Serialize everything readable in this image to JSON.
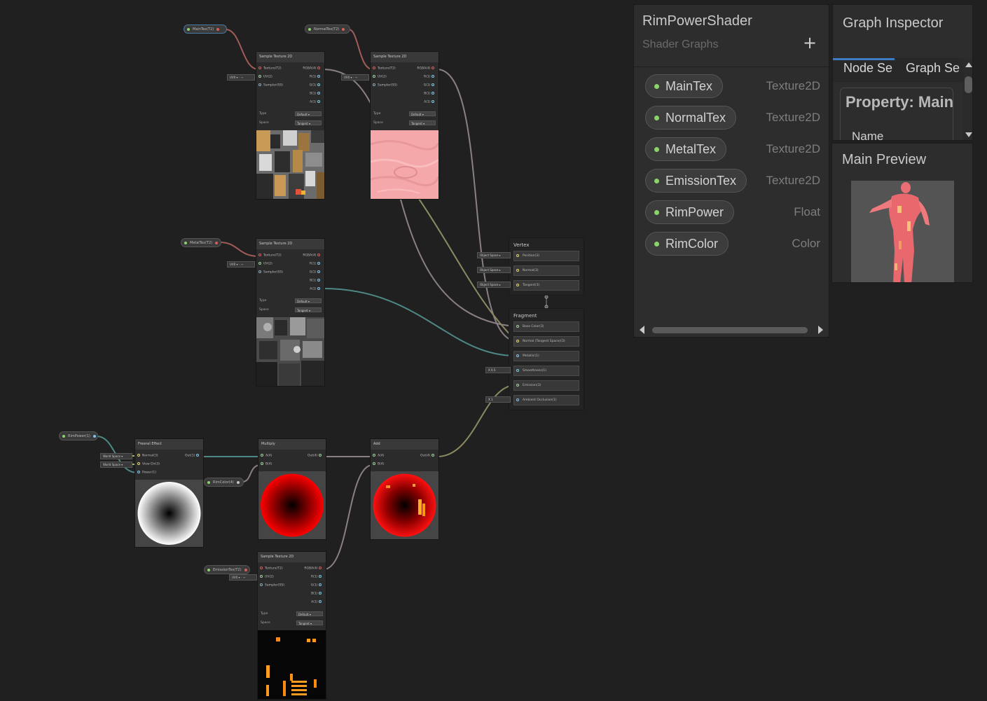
{
  "blackboard": {
    "title": "RimPowerShader",
    "subtitle": "Shader Graphs",
    "add_label": "+",
    "properties": [
      {
        "name": "MainTex",
        "type": "Texture2D"
      },
      {
        "name": "NormalTex",
        "type": "Texture2D"
      },
      {
        "name": "MetalTex",
        "type": "Texture2D"
      },
      {
        "name": "EmissionTex",
        "type": "Texture2D"
      },
      {
        "name": "RimPower",
        "type": "Float"
      },
      {
        "name": "RimColor",
        "type": "Color"
      }
    ]
  },
  "inspector": {
    "title": "Graph Inspector",
    "tabs": [
      "Node Se",
      "Graph Se"
    ],
    "property_heading": "Property: Main",
    "field_name": "Name"
  },
  "main_preview": {
    "title": "Main Preview"
  },
  "graph": {
    "prop_nodes": {
      "maintex": "MainTex(T2)",
      "normaltex": "NormalTex(T2)",
      "metaltex": "MetalTex(T2)",
      "rimpower": "RimPower(1)",
      "rimcolor": "RimColor(4)",
      "emissiontex": "EmissionTex(T2)"
    },
    "sample": {
      "title": "Sample Texture 2D",
      "inputs": [
        "Texture(T2)",
        "UV(2)",
        "Sampler(SS)"
      ],
      "outputs": [
        "RGBA(4)",
        "R(1)",
        "G(1)",
        "B(1)",
        "A(1)"
      ],
      "uv_label": "UV0",
      "type_label": "Type",
      "space_label": "Space",
      "type_default": "Default",
      "space_tangent": "Tangent"
    },
    "fresnel": {
      "title": "Fresnel Effect",
      "inputs": [
        "Normal(3)",
        "View Dir(3)",
        "Power(1)"
      ],
      "output": "Out(1)",
      "world_space": "World Space"
    },
    "multiply": {
      "title": "Multiply",
      "inputs": [
        "A(4)",
        "B(4)"
      ],
      "output": "Out(4)"
    },
    "add": {
      "title": "Add",
      "inputs": [
        "A(4)",
        "B(4)"
      ],
      "output": "Out(4)"
    },
    "vertex": {
      "title": "Vertex",
      "slots": [
        "Position(3)",
        "Normal(3)",
        "Tangent(3)"
      ],
      "space_label": "Object Space"
    },
    "fragment": {
      "title": "Fragment",
      "slots": [
        "Base Color(3)",
        "Normal (Tangent Space)(3)",
        "Metallic(1)",
        "Smoothness(1)",
        "Emission(3)",
        "Ambient Occlusion(1)"
      ],
      "smoothness_value": "X  0.5",
      "ao_value": "X  1"
    }
  },
  "colors": {
    "bg": "#202020",
    "accent": "#3d7bc4",
    "property_dot": "#8bd36b"
  }
}
